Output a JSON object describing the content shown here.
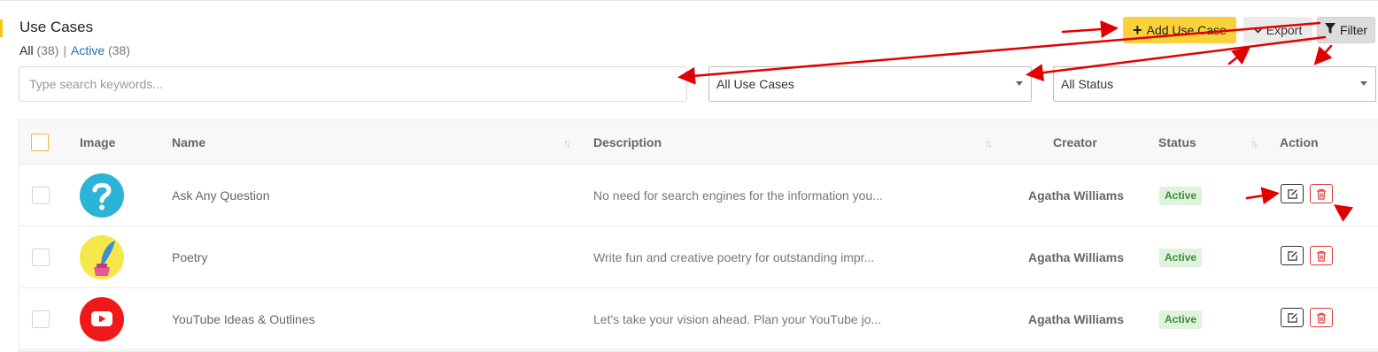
{
  "header": {
    "title": "Use Cases",
    "tabs": {
      "all_label": "All",
      "all_count": "(38)",
      "separator": "|",
      "active_label": "Active",
      "active_count": "(38)"
    }
  },
  "toolbar": {
    "add_label": "Add Use Case",
    "export_label": "Export",
    "filter_label": "Filter"
  },
  "search": {
    "placeholder": "Type search keywords...",
    "value": ""
  },
  "filters": {
    "use_cases": {
      "selected": "All Use Cases"
    },
    "status": {
      "selected": "All Status"
    }
  },
  "table": {
    "columns": {
      "image": "Image",
      "name": "Name",
      "description": "Description",
      "creator": "Creator",
      "status": "Status",
      "action": "Action"
    },
    "rows": [
      {
        "icon": "question-mark-icon",
        "name": "Ask Any Question",
        "description": "No need for search engines for the information you...",
        "creator": "Agatha Williams",
        "status": "Active"
      },
      {
        "icon": "quill-ink-icon",
        "name": "Poetry",
        "description": "Write fun and creative poetry for outstanding impr...",
        "creator": "Agatha Williams",
        "status": "Active"
      },
      {
        "icon": "youtube-play-icon",
        "name": "YouTube Ideas & Outlines",
        "description": "Let's take your vision ahead. Plan your YouTube jo...",
        "creator": "Agatha Williams",
        "status": "Active"
      }
    ]
  },
  "colors": {
    "accent": "#f9d13a",
    "link": "#1a73b8",
    "status_active_bg": "#dff3dc",
    "status_active_text": "#3d8b3d",
    "delete": "#e03b3b",
    "annotation_arrow": "#e00000"
  }
}
